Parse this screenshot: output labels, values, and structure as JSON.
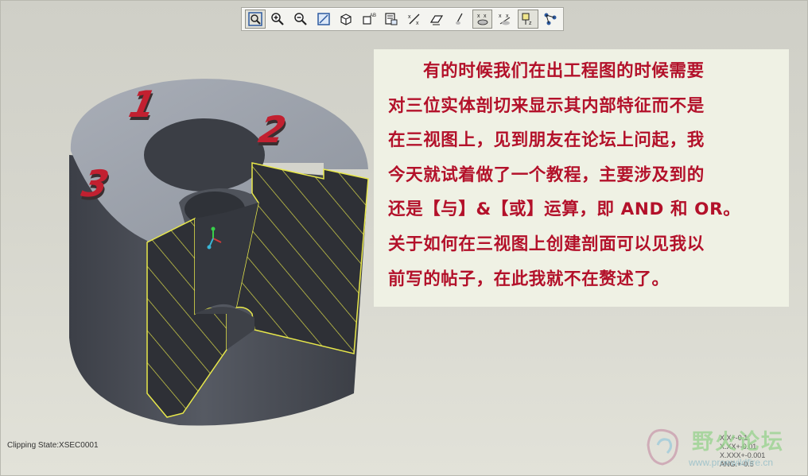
{
  "toolbar": {
    "tools": [
      {
        "icon": "zoom-fit-icon",
        "active": true
      },
      {
        "icon": "zoom-in-icon",
        "active": false
      },
      {
        "icon": "zoom-out-icon",
        "active": false
      },
      {
        "icon": "repaint-icon",
        "active": false
      },
      {
        "icon": "shading-icon",
        "active": false
      },
      {
        "icon": "saved-views-icon",
        "active": false
      },
      {
        "icon": "layer-icon",
        "active": false
      },
      {
        "icon": "datum-planes-icon",
        "active": false
      },
      {
        "icon": "datum-axes-icon",
        "active": false
      },
      {
        "icon": "datum-points-icon",
        "active": false
      },
      {
        "icon": "csys-icon",
        "active": true
      },
      {
        "icon": "annotation-icon",
        "active": false
      },
      {
        "icon": "spin-center-icon",
        "active": true
      },
      {
        "icon": "model-tree-icon",
        "active": false
      }
    ]
  },
  "note": {
    "lines": [
      "有的时候我们在出工程图的时候需要",
      "对三位实体剖切来显示其内部特征而不是",
      "在三视图上，见到朋友在论坛上问起，我",
      "今天就试着做了一个教程，主要涉及到的",
      "还是【与】&【或】运算，即 AND 和 OR。",
      "关于如何在三视图上创建剖面可以见我以",
      "前写的帖子，在此我就不在赘述了。"
    ],
    "text_color": "#b3112a",
    "background": "#eff1e4"
  },
  "model": {
    "labels": [
      "1",
      "2",
      "3"
    ],
    "section_hatch_color": "#e8e84a",
    "body_color": "#4a4d55",
    "top_color": "#9ba1ab"
  },
  "status": {
    "clipping_state": "Clipping State:XSEC0001",
    "tolerances": [
      "X.X+-0.1",
      "X.XX+-0.01",
      "X.XXX+-0.001",
      "ANG.+-0.5"
    ]
  },
  "watermark": {
    "title": "野火论坛",
    "url": "www.proewildfire.cn"
  }
}
